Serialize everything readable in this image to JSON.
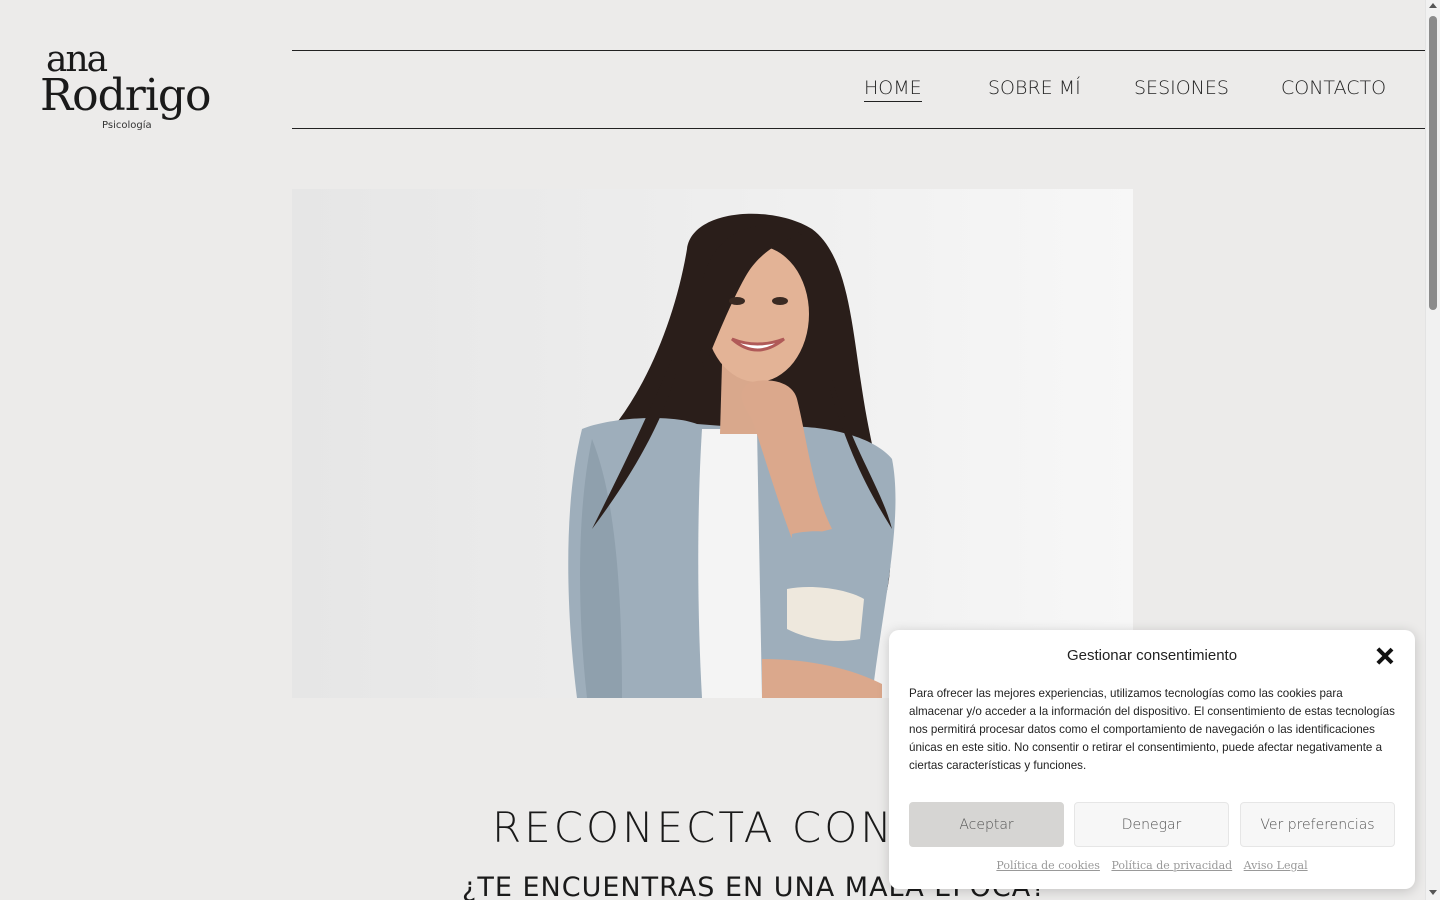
{
  "logo": {
    "line1": "ana",
    "line2": "Rodrigo",
    "line3": "Psicología"
  },
  "nav": {
    "items": [
      {
        "label": "HOME",
        "active": true
      },
      {
        "label": "SOBRE MÍ",
        "active": false
      },
      {
        "label": "SESIONES",
        "active": false
      },
      {
        "label": "CONTACTO",
        "active": false
      }
    ]
  },
  "main": {
    "headline": "RECONECTA CONTIGO",
    "subheadline": "¿TE ENCUENTRAS EN UNA MALA ÉPOCA?"
  },
  "cookie_dialog": {
    "title": "Gestionar consentimiento",
    "body": "Para ofrecer las mejores experiencias, utilizamos tecnologías como las cookies para almacenar y/o acceder a la información del dispositivo. El consentimiento de estas tecnologías nos permitirá procesar datos como el comportamiento de navegación o las identificaciones únicas en este sitio. No consentir o retirar el consentimiento, puede afectar negativamente a ciertas características y funciones.",
    "accept_label": "Aceptar",
    "deny_label": "Denegar",
    "prefs_label": "Ver preferencias",
    "links": [
      "Política de cookies",
      "Política de privacidad",
      "Aviso Legal"
    ]
  },
  "colors": {
    "background": "#ecebea",
    "text": "#1a1a1a",
    "accept_button": "#d6d5d3",
    "link": "#999999"
  }
}
